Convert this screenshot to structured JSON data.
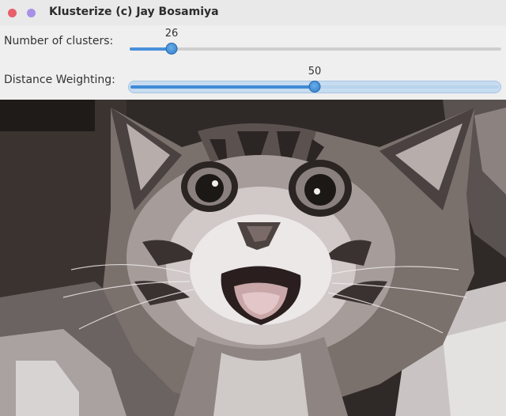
{
  "window": {
    "title": "Klusterize (c) Jay Bosamiya",
    "close_color": "#e85f6b",
    "minimize_color": "#a890e7"
  },
  "controls": {
    "clusters": {
      "label": "Number of clusters:",
      "value": "26",
      "fraction": 0.11
    },
    "weighting": {
      "label": "Distance Weighting:",
      "value": "50",
      "fraction": 0.5
    }
  },
  "image": {
    "subject": "posterized photo of a happy tabby kitten with open mouth"
  }
}
